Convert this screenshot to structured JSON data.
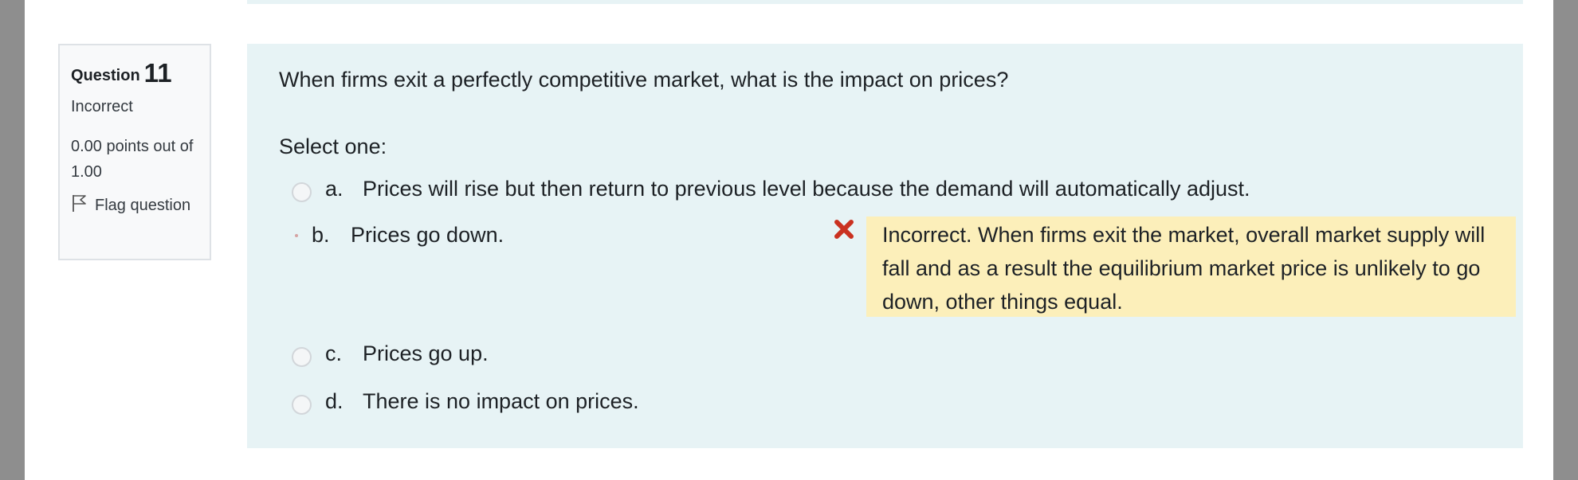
{
  "question_info": {
    "label": "Question",
    "number": "11",
    "state": "Incorrect",
    "grade": "0.00 points out of 1.00",
    "flag_label": "Flag question"
  },
  "question": {
    "text": "When firms exit a perfectly competitive market, what is the impact on prices?",
    "prompt": "Select one:",
    "answers": [
      {
        "letter": "a.",
        "text": "Prices will rise but then return to previous level because the demand will automatically adjust.",
        "selected": false
      },
      {
        "letter": "b.",
        "text": "Prices go down.",
        "selected": true
      },
      {
        "letter": "c.",
        "text": "Prices go up.",
        "selected": false
      },
      {
        "letter": "d.",
        "text": "There is no impact on prices.",
        "selected": false
      }
    ],
    "feedback": "Incorrect. When firms exit the market, overall market supply will fall and as a result the equilibrium market price is unlikely to go down, other things equal."
  },
  "colors": {
    "content_bg": "#e7f3f5",
    "feedback_bg": "#fcefba",
    "incorrect_icon": "#ca3120"
  },
  "icons": {
    "flag": "flag-icon",
    "incorrect": "incorrect-x-icon"
  }
}
